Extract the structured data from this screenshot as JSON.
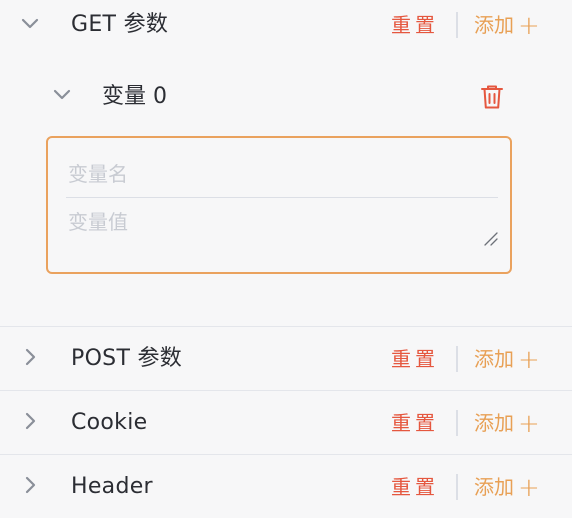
{
  "sections": [
    {
      "title": "GET 参数",
      "expanded": true,
      "reset_label": "重置",
      "add_label": "添加",
      "add_icon": "plus-icon"
    },
    {
      "title": "POST 参数",
      "expanded": false,
      "reset_label": "重置",
      "add_label": "添加",
      "add_icon": "plus-icon"
    },
    {
      "title": "Cookie",
      "expanded": false,
      "reset_label": "重置",
      "add_label": "添加",
      "add_icon": "plus-icon"
    },
    {
      "title": "Header",
      "expanded": false,
      "reset_label": "重置",
      "add_label": "添加",
      "add_icon": "plus-icon"
    }
  ],
  "get_variables": [
    {
      "title": "变量 0",
      "expanded": true,
      "delete_icon": "trash-icon",
      "name_value": "",
      "name_placeholder": "变量名",
      "value_value": "",
      "value_placeholder": "变量值"
    }
  ],
  "colors": {
    "background": "#f7f7f8",
    "reset": "#e5573f",
    "add": "#e8a055",
    "active_border": "#eaa25e",
    "chevron": "#8a8f99",
    "divider": "#e4e6eb"
  }
}
